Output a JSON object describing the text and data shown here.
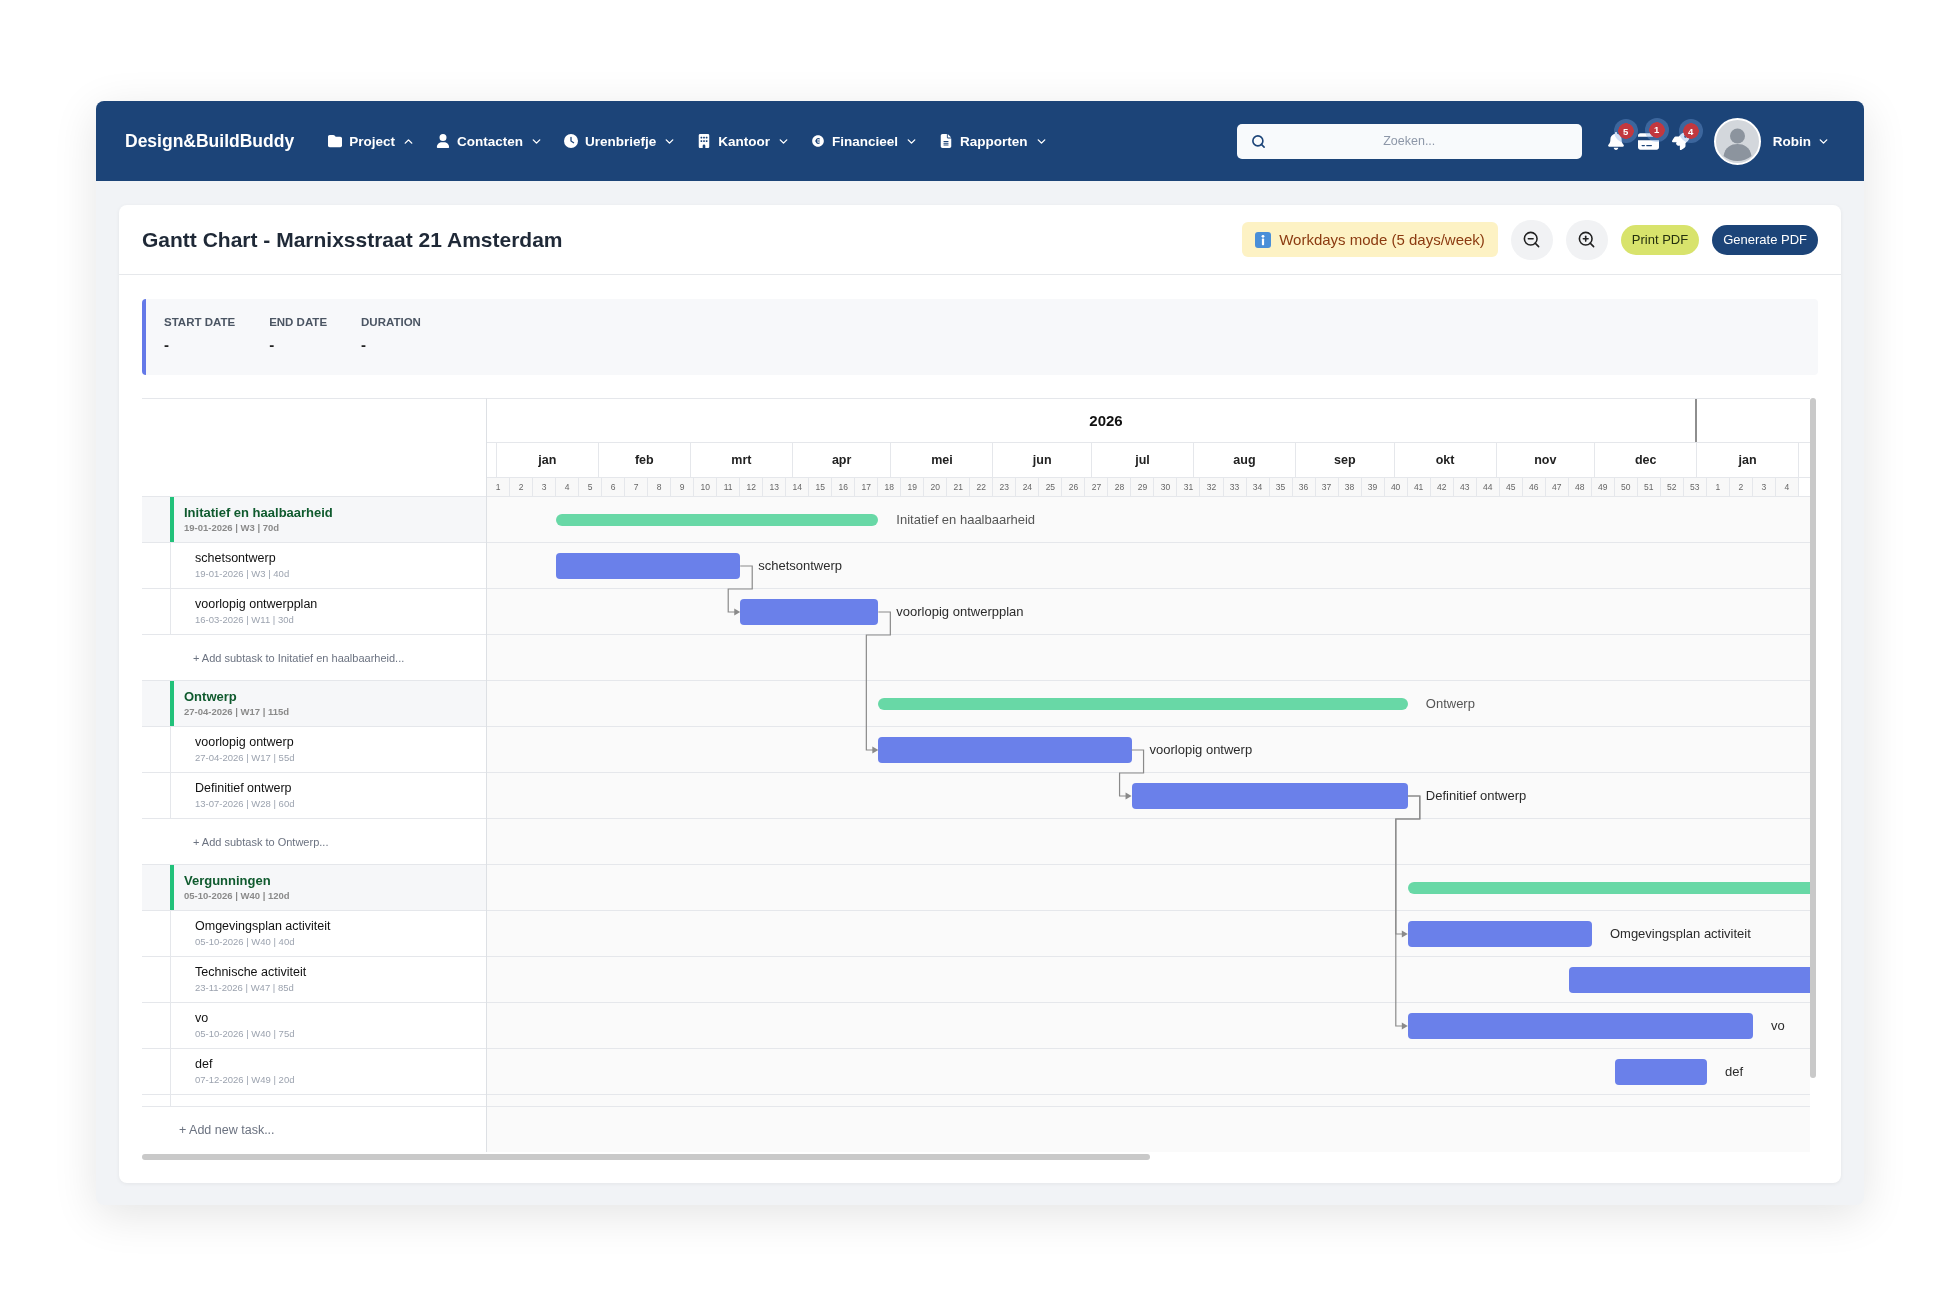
{
  "nav": {
    "brand": "Design&BuildBuddy",
    "menus": [
      {
        "label": "Project",
        "expanded": true
      },
      {
        "label": "Contacten",
        "expanded": false
      },
      {
        "label": "Urenbriefje",
        "expanded": false
      },
      {
        "label": "Kantoor",
        "expanded": false
      },
      {
        "label": "Financieel",
        "expanded": false
      },
      {
        "label": "Rapporten",
        "expanded": false
      }
    ],
    "search": {
      "placeholder": "Zoeken..."
    },
    "indicators": [
      {
        "badge": "5"
      },
      {
        "badge": "1"
      },
      {
        "badge": "4"
      }
    ],
    "user": {
      "name": "Robin"
    }
  },
  "header": {
    "title": "Gantt Chart - Marnixsstraat 21 Amsterdam",
    "mode": "Workdays mode (5 days/week)",
    "buttons": [
      {
        "label": "Print PDF",
        "kind": "secondary"
      },
      {
        "label": "Generate PDF",
        "kind": "primary"
      }
    ]
  },
  "summary": [
    {
      "label": "START DATE",
      "value": "-"
    },
    {
      "label": "END DATE",
      "value": "-"
    },
    {
      "label": "DURATION",
      "value": "-"
    }
  ],
  "timeline": {
    "year": "2026",
    "months": [
      "jan",
      "feb",
      "mrt",
      "apr",
      "mei",
      "jun",
      "jul",
      "aug",
      "sep",
      "okt",
      "nov",
      "dec",
      "jan"
    ],
    "weeks": [
      "1",
      "2",
      "3",
      "4",
      "5",
      "6",
      "7",
      "8",
      "9",
      "10",
      "11",
      "12",
      "13",
      "14",
      "15",
      "16",
      "17",
      "18",
      "19",
      "20",
      "21",
      "22",
      "23",
      "24",
      "25",
      "26",
      "27",
      "28",
      "29",
      "30",
      "31",
      "32",
      "33",
      "34",
      "35",
      "36",
      "37",
      "38",
      "39",
      "40",
      "41",
      "42",
      "43",
      "44",
      "45",
      "46",
      "47",
      "48",
      "49",
      "50",
      "51",
      "52",
      "53",
      "1",
      "2",
      "3",
      "4"
    ]
  },
  "groups": [
    {
      "name": "Initatief en haalbaarheid",
      "meta": "19-01-2026 | W3 | 70d",
      "bar_label": "Initatief en haalbaarheid",
      "children": [
        {
          "name": "schetsontwerp",
          "meta": "19-01-2026 | W3 | 40d",
          "bar_label": "schetsontwerp",
          "linked_in": false,
          "linked_out": true
        },
        {
          "name": "voorlopig ontwerpplan",
          "meta": "16-03-2026 | W11 | 30d",
          "bar_label": "voorlopig ontwerpplan",
          "linked_in": true,
          "linked_out": true
        }
      ],
      "add_subtask": "+ Add subtask to Initatief en haalbaarheid..."
    },
    {
      "name": "Ontwerp",
      "meta": "27-04-2026 | W17 | 115d",
      "bar_label": "Ontwerp",
      "children": [
        {
          "name": "voorlopig ontwerp",
          "meta": "27-04-2026 | W17 | 55d",
          "bar_label": "voorlopig ontwerp",
          "linked_in": true,
          "linked_out": true
        },
        {
          "name": "Definitief ontwerp",
          "meta": "13-07-2026 | W28 | 60d",
          "bar_label": "Definitief ontwerp",
          "linked_in": true,
          "linked_out": true
        }
      ],
      "add_subtask": "+ Add subtask to Ontwerp..."
    },
    {
      "name": "Vergunningen",
      "meta": "05-10-2026 | W40 | 120d",
      "children": [
        {
          "name": "Omgevingsplan activiteit",
          "meta": "05-10-2026 | W40 | 40d",
          "bar_label": "Omgevingsplan activiteit",
          "linked_in": true,
          "linked_out": false
        },
        {
          "name": "Technische activiteit",
          "meta": "23-11-2026 | W47 | 85d",
          "linked_in": false,
          "linked_out": false
        },
        {
          "name": "vo",
          "meta": "05-10-2026 | W40 | 75d",
          "bar_label": "vo",
          "linked_in": true,
          "linked_out": false
        },
        {
          "name": "def",
          "meta": "07-12-2026 | W49 | 20d",
          "bar_label": "def",
          "linked_in": false,
          "linked_out": false
        }
      ]
    }
  ],
  "add_task": "+ Add new task..."
}
